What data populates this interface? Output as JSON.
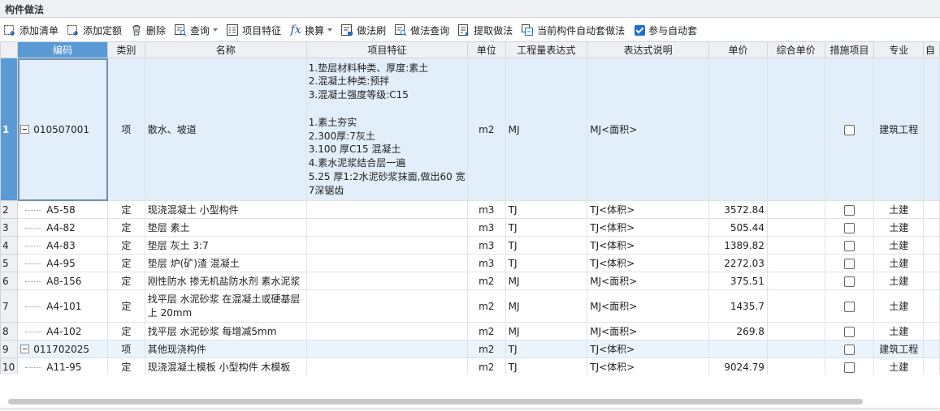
{
  "panel": {
    "title": "构件做法"
  },
  "toolbar": {
    "add_list": "添加清单",
    "add_quota": "添加定额",
    "delete": "删除",
    "query": "查询",
    "item_feature": "项目特征",
    "convert": "换算",
    "method_brush": "做法刷",
    "method_query": "做法查询",
    "extract_method": "提取做法",
    "auto_method": "当前构件自动套做法",
    "auto_participate": "参与自动套"
  },
  "columns": [
    "编码",
    "类别",
    "名称",
    "项目特征",
    "单位",
    "工程量表达式",
    "表达式说明",
    "单价",
    "综合单价",
    "措施项目",
    "专业",
    "自"
  ],
  "rows": [
    {
      "n": "1",
      "code": "010507001",
      "type": "项",
      "name": "散水、坡道",
      "spec": "1.垫层材料种类、厚度:素土\n2.混凝土种类:预拌\n3.混凝土强度等级:C15\n\n1.素土夯实\n2.300厚:7灰土\n3.100 厚C15 混凝土\n4.素水泥浆结合层一遍\n5.25 厚1:2水泥砂浆抹面,做出60 宽7深锯齿",
      "unit": "m2",
      "expr": "MJ",
      "desc": "MJ<面积>",
      "price": "",
      "comp": "",
      "checked": false,
      "major": "建筑工程"
    },
    {
      "n": "2",
      "code": "A5-58",
      "type": "定",
      "name": "现浇混凝土 小型构件",
      "spec": "",
      "unit": "m3",
      "expr": "TJ",
      "desc": "TJ<体积>",
      "price": "3572.84",
      "comp": "",
      "checked": false,
      "major": "土建"
    },
    {
      "n": "3",
      "code": "A4-82",
      "type": "定",
      "name": "垫层 素土",
      "spec": "",
      "unit": "m3",
      "expr": "TJ",
      "desc": "TJ<体积>",
      "price": "505.44",
      "comp": "",
      "checked": false,
      "major": "土建"
    },
    {
      "n": "4",
      "code": "A4-83",
      "type": "定",
      "name": "垫层 灰土 3:7",
      "spec": "",
      "unit": "m3",
      "expr": "TJ",
      "desc": "TJ<体积>",
      "price": "1389.82",
      "comp": "",
      "checked": false,
      "major": "土建"
    },
    {
      "n": "5",
      "code": "A4-95",
      "type": "定",
      "name": "垫层 炉(矿)渣 混凝土",
      "spec": "",
      "unit": "m3",
      "expr": "TJ",
      "desc": "TJ<体积>",
      "price": "2272.03",
      "comp": "",
      "checked": false,
      "major": "土建"
    },
    {
      "n": "6",
      "code": "A8-156",
      "type": "定",
      "name": "刚性防水 掺无机盐防水剂 素水泥浆",
      "spec": "",
      "unit": "m2",
      "expr": "MJ",
      "desc": "MJ<面积>",
      "price": "375.51",
      "comp": "",
      "checked": false,
      "major": "土建"
    },
    {
      "n": "7",
      "code": "A4-101",
      "type": "定",
      "name": "找平层 水泥砂浆 在混凝土或硬基层上 20mm",
      "spec": "",
      "unit": "m2",
      "expr": "MJ",
      "desc": "MJ<面积>",
      "price": "1435.7",
      "comp": "",
      "checked": false,
      "major": "土建"
    },
    {
      "n": "8",
      "code": "A4-102",
      "type": "定",
      "name": "找平层 水泥砂浆 每增减5mm",
      "spec": "",
      "unit": "m2",
      "expr": "MJ",
      "desc": "MJ<面积>",
      "price": "269.8",
      "comp": "",
      "checked": false,
      "major": "土建"
    },
    {
      "n": "9",
      "code": "011702025",
      "type": "项",
      "name": "其他现浇构件",
      "spec": "",
      "unit": "m2",
      "expr": "TJ",
      "desc": "TJ<体积>",
      "price": "",
      "comp": "",
      "checked": false,
      "major": "建筑工程"
    },
    {
      "n": "10",
      "code": "A11-95",
      "type": "定",
      "name": "现浇混凝土模板 小型构件 木模板",
      "spec": "",
      "unit": "m2",
      "expr": "TJ",
      "desc": "TJ<体积>",
      "price": "9024.79",
      "comp": "",
      "checked": false,
      "major": "土建"
    }
  ]
}
